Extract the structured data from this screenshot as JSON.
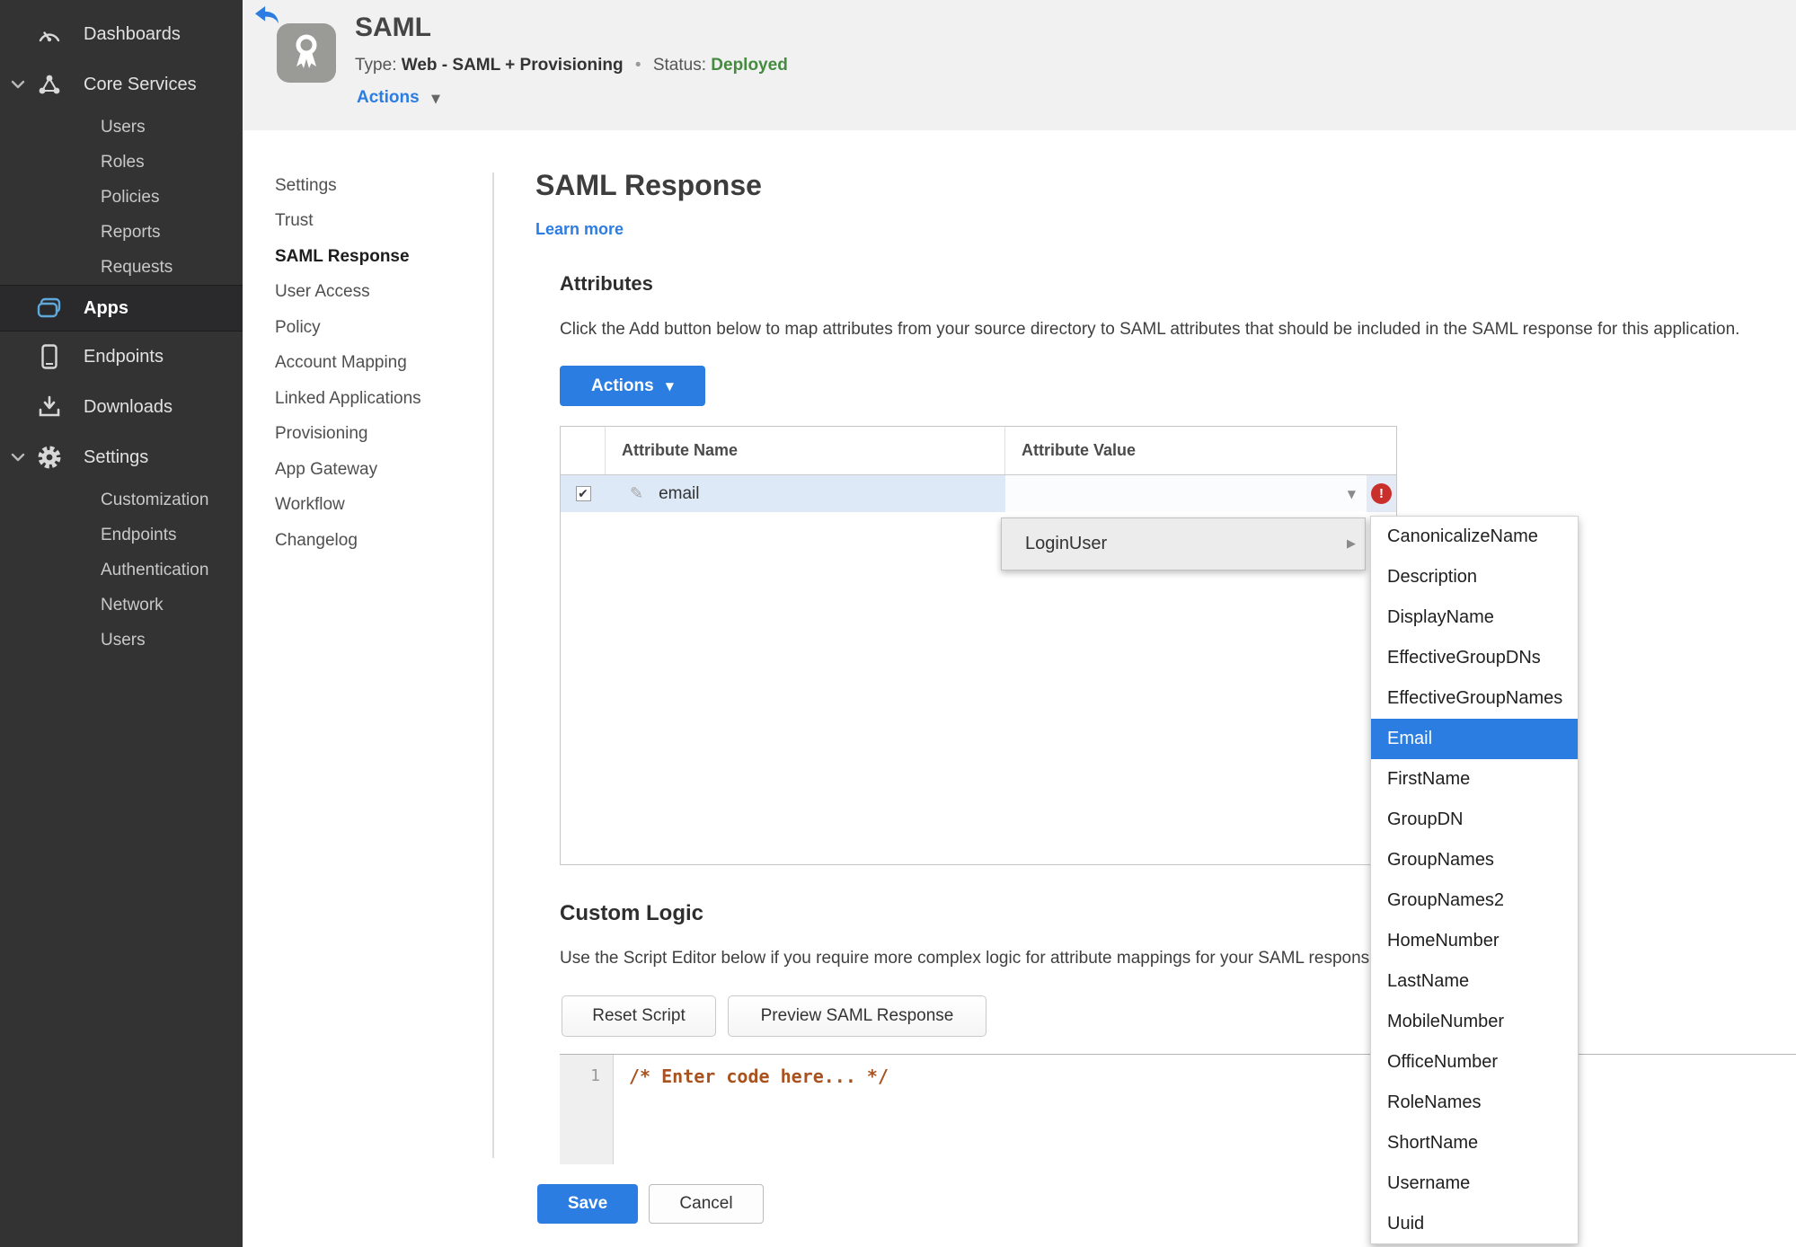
{
  "colors": {
    "accent": "#2b7de2",
    "status_green": "#448a3f",
    "error_red": "#c9302c"
  },
  "sidebar": {
    "dashboards": "Dashboards",
    "core_services": {
      "label": "Core Services",
      "children": [
        "Users",
        "Roles",
        "Policies",
        "Reports",
        "Requests"
      ]
    },
    "apps": "Apps",
    "endpoints": "Endpoints",
    "downloads": "Downloads",
    "settings": {
      "label": "Settings",
      "children": [
        "Customization",
        "Endpoints",
        "Authentication",
        "Network",
        "Users"
      ]
    }
  },
  "header": {
    "title": "SAML",
    "type_label": "Type:",
    "type_value": "Web - SAML + Provisioning",
    "dot": "•",
    "status_label": "Status:",
    "status_value": "Deployed",
    "actions_label": "Actions"
  },
  "subnav": {
    "items": [
      {
        "label": "Settings"
      },
      {
        "label": "Trust"
      },
      {
        "label": "SAML Response",
        "active": true
      },
      {
        "label": "User Access"
      },
      {
        "label": "Policy"
      },
      {
        "label": "Account Mapping"
      },
      {
        "label": "Linked Applications"
      },
      {
        "label": "Provisioning"
      },
      {
        "label": "App Gateway"
      },
      {
        "label": "Workflow"
      },
      {
        "label": "Changelog"
      }
    ]
  },
  "page": {
    "title": "SAML Response",
    "learn_more": "Learn more"
  },
  "attributes": {
    "heading": "Attributes",
    "description": "Click the Add button below to map attributes from your source directory to SAML attributes that should be included in the SAML response for this application.",
    "actions_label": "Actions",
    "table": {
      "col_name": "Attribute Name",
      "col_value": "Attribute Value",
      "row": {
        "name": "email",
        "checked": "✔",
        "error": "!"
      }
    }
  },
  "value_menu": {
    "label": "LoginUser",
    "options": [
      {
        "label": "CanonicalizeName"
      },
      {
        "label": "Description"
      },
      {
        "label": "DisplayName"
      },
      {
        "label": "EffectiveGroupDNs"
      },
      {
        "label": "EffectiveGroupNames"
      },
      {
        "label": "Email",
        "active": true
      },
      {
        "label": "FirstName"
      },
      {
        "label": "GroupDN"
      },
      {
        "label": "GroupNames"
      },
      {
        "label": "GroupNames2"
      },
      {
        "label": "HomeNumber"
      },
      {
        "label": "LastName"
      },
      {
        "label": "MobileNumber"
      },
      {
        "label": "OfficeNumber"
      },
      {
        "label": "RoleNames"
      },
      {
        "label": "ShortName"
      },
      {
        "label": "Username"
      },
      {
        "label": "Uuid"
      }
    ]
  },
  "custom_logic": {
    "heading": "Custom Logic",
    "description": "Use the Script Editor below if you require more complex logic for attribute mappings for your SAML response.",
    "reset_label": "Reset Script",
    "preview_label": "Preview SAML Response",
    "line_number": "1",
    "code": "/* Enter code here... */"
  },
  "footer": {
    "save": "Save",
    "cancel": "Cancel"
  }
}
